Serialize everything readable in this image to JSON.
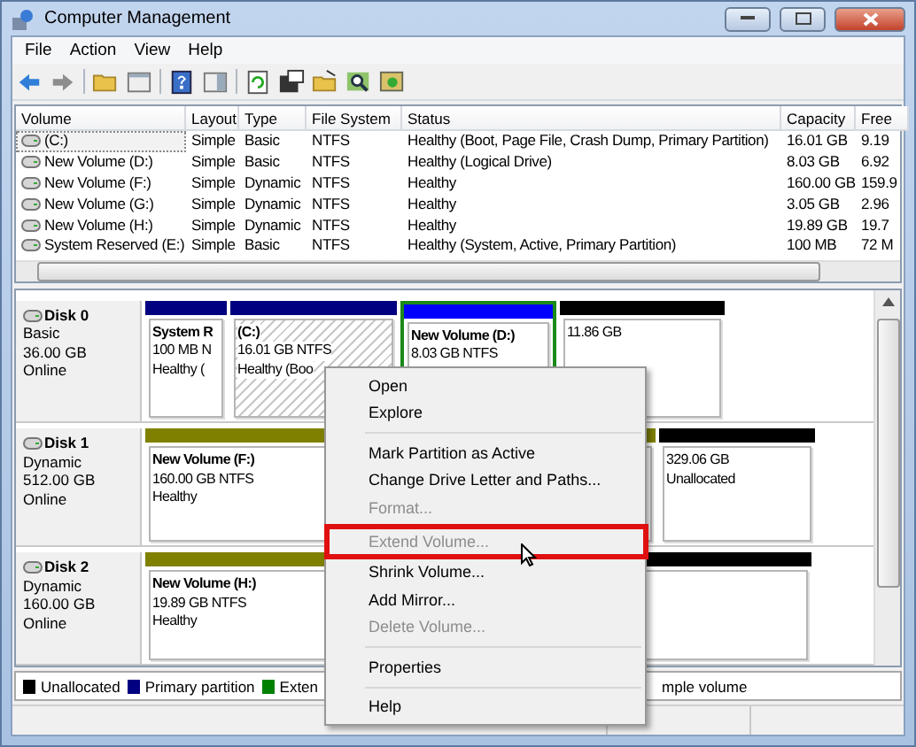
{
  "window": {
    "title": "Computer Management"
  },
  "menu_bar": [
    "File",
    "Action",
    "View",
    "Help"
  ],
  "volume_table": {
    "columns": [
      "Volume",
      "Layout",
      "Type",
      "File System",
      "Status",
      "Capacity",
      "Free"
    ],
    "rows": [
      {
        "cells": [
          "(C:)",
          "Simple",
          "Basic",
          "NTFS",
          "Healthy (Boot, Page File, Crash Dump, Primary Partition)",
          "16.01 GB",
          "9.19"
        ],
        "selected": true
      },
      {
        "cells": [
          "New Volume (D:)",
          "Simple",
          "Basic",
          "NTFS",
          "Healthy (Logical Drive)",
          "8.03 GB",
          "6.92"
        ],
        "selected": false
      },
      {
        "cells": [
          "New Volume (F:)",
          "Simple",
          "Dynamic",
          "NTFS",
          "Healthy",
          "160.00 GB",
          "159.9"
        ],
        "selected": false
      },
      {
        "cells": [
          "New Volume (G:)",
          "Simple",
          "Dynamic",
          "NTFS",
          "Healthy",
          "3.05 GB",
          "2.96"
        ],
        "selected": false
      },
      {
        "cells": [
          "New Volume (H:)",
          "Simple",
          "Dynamic",
          "NTFS",
          "Healthy",
          "19.89 GB",
          "19.7"
        ],
        "selected": false
      },
      {
        "cells": [
          "System Reserved (E:)",
          "Simple",
          "Basic",
          "NTFS",
          "Healthy (System, Active, Primary Partition)",
          "100 MB",
          "72 M"
        ],
        "selected": false
      }
    ]
  },
  "disks": [
    {
      "name": "Disk 0",
      "type": "Basic",
      "size": "36.00 GB",
      "status": "Online",
      "partitions": [
        {
          "kind": "primary",
          "selected": false,
          "lines": [
            "System R",
            "100 MB N",
            "Healthy ("
          ]
        },
        {
          "kind": "primary",
          "selected": true,
          "lines": [
            "(C:)",
            "16.01 GB NTFS",
            "Healthy (Boo"
          ]
        },
        {
          "kind": "logical",
          "selected": false,
          "lines": [
            "New Volume  (D:)",
            "8.03 GB NTFS"
          ]
        },
        {
          "kind": "unallocated",
          "selected": false,
          "lines": [
            "11.86 GB"
          ]
        }
      ]
    },
    {
      "name": "Disk 1",
      "type": "Dynamic",
      "size": "512.00 GB",
      "status": "Online",
      "partitions": [
        {
          "kind": "simple",
          "selected": false,
          "lines": [
            "New Volume  (F:)",
            "160.00 GB NTFS",
            "Healthy"
          ]
        },
        {
          "kind": "unallocated",
          "selected": false,
          "lines": [
            "329.06 GB",
            "Unallocated"
          ]
        }
      ]
    },
    {
      "name": "Disk 2",
      "type": "Dynamic",
      "size": "160.00 GB",
      "status": "Online",
      "partitions": [
        {
          "kind": "simple",
          "selected": false,
          "lines": [
            "New Volume  (H:)",
            "19.89 GB NTFS",
            "Healthy"
          ]
        },
        {
          "kind": "unallocated",
          "selected": false
        }
      ]
    }
  ],
  "legend": [
    {
      "label": "Unallocated",
      "color": "#000000"
    },
    {
      "label": "Primary partition",
      "color": "#000080"
    },
    {
      "label": "Exten",
      "color": "#008000"
    },
    {
      "label": "mple volume"
    }
  ],
  "context_menu": [
    {
      "kind": "item",
      "label": "Open",
      "disabled": false,
      "highlighted": false
    },
    {
      "kind": "item",
      "label": "Explore",
      "disabled": false,
      "highlighted": false
    },
    {
      "kind": "separator"
    },
    {
      "kind": "item",
      "label": "Mark Partition as Active",
      "disabled": false,
      "highlighted": false
    },
    {
      "kind": "item",
      "label": "Change Drive Letter and Paths...",
      "disabled": false,
      "highlighted": false
    },
    {
      "kind": "item",
      "label": "Format...",
      "disabled": true,
      "highlighted": false
    },
    {
      "kind": "item",
      "label": "Extend Volume...",
      "disabled": true,
      "highlighted": true
    },
    {
      "kind": "item",
      "label": "Shrink Volume...",
      "disabled": false,
      "highlighted": false
    },
    {
      "kind": "item",
      "label": "Add Mirror...",
      "disabled": false,
      "highlighted": false
    },
    {
      "kind": "item",
      "label": "Delete Volume...",
      "disabled": true,
      "highlighted": false
    },
    {
      "kind": "separator"
    },
    {
      "kind": "item",
      "label": "Properties",
      "disabled": false,
      "highlighted": false
    },
    {
      "kind": "separator"
    },
    {
      "kind": "item",
      "label": "Help",
      "disabled": false,
      "highlighted": false
    }
  ]
}
